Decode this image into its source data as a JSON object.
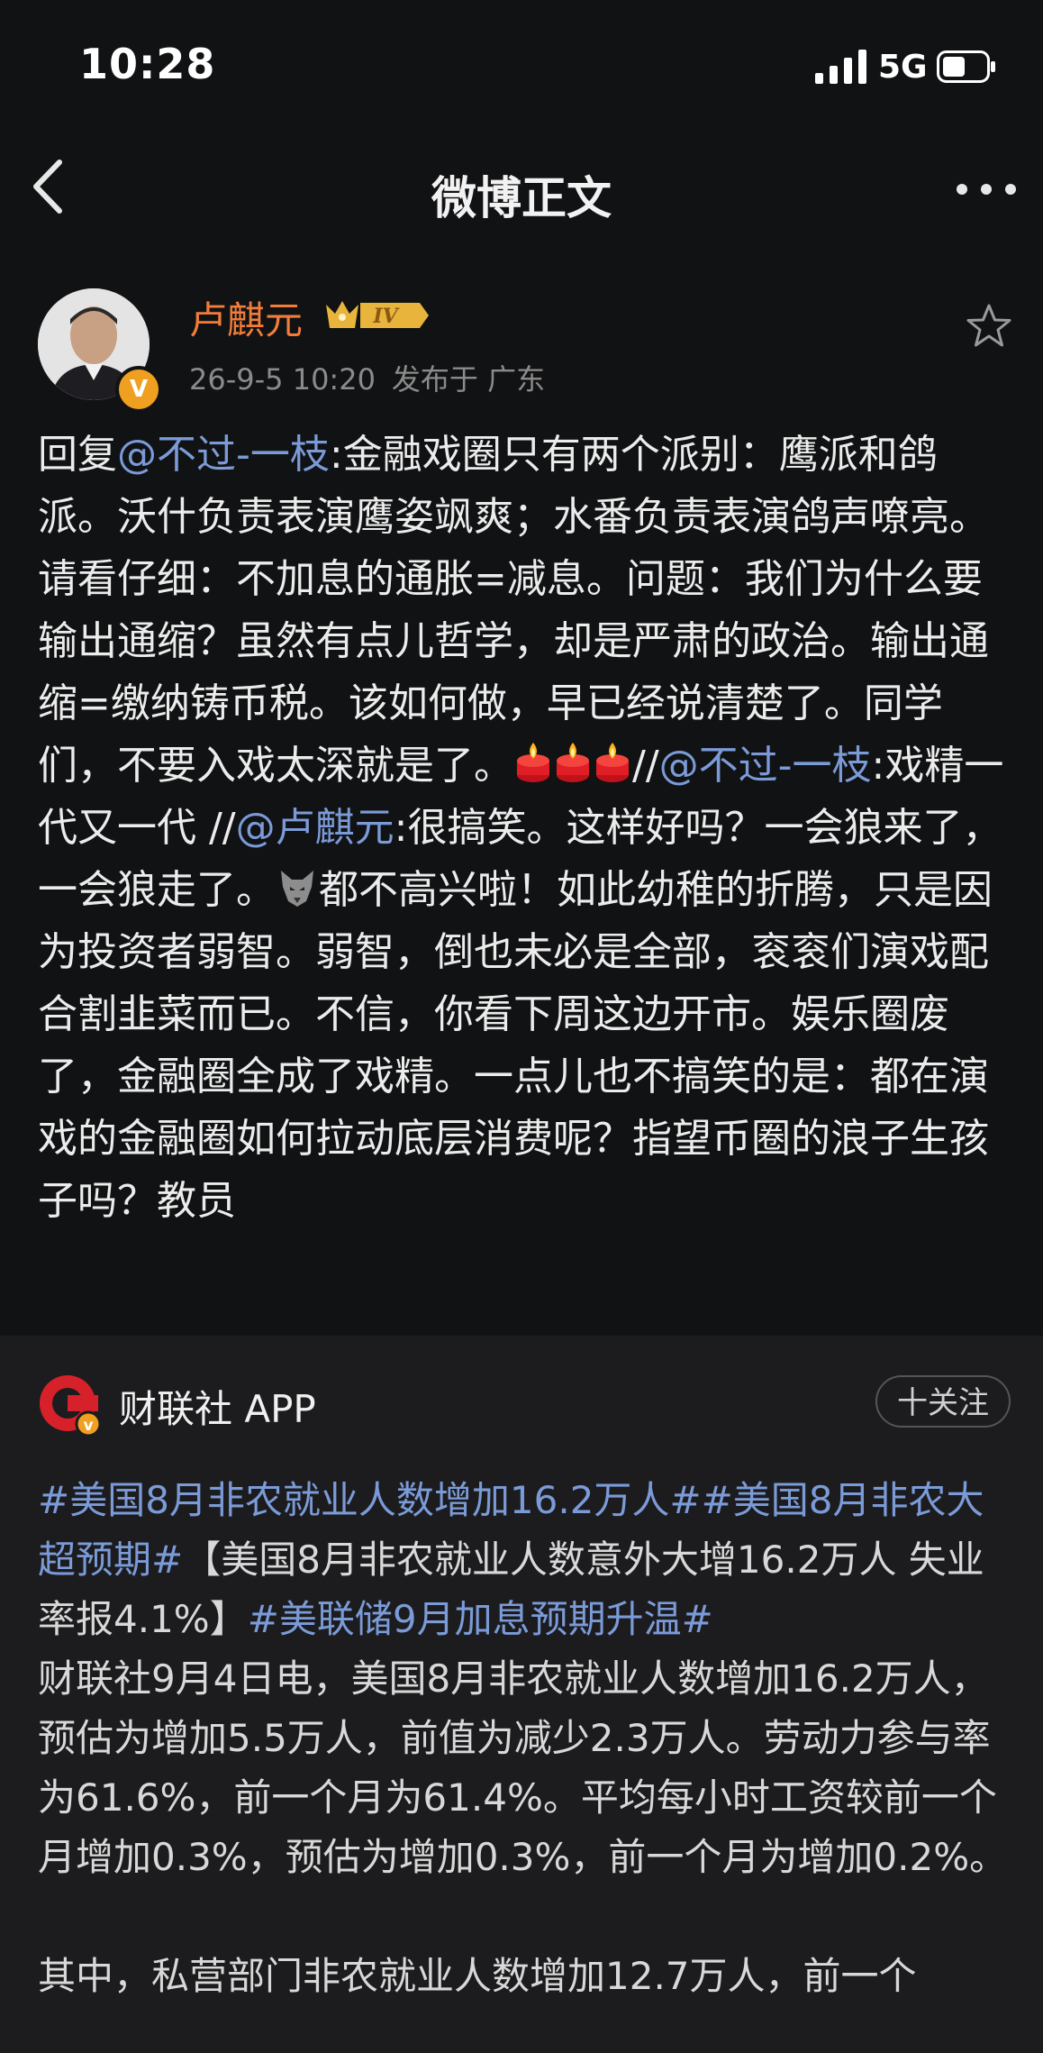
{
  "status_bar": {
    "time": "10:28",
    "network": "5G"
  },
  "nav": {
    "title": "微博正文"
  },
  "author": {
    "name": "卢麒元",
    "level_badge": "IV",
    "verified_badge": "V",
    "timestamp": "26-9-5 10:20",
    "location": "发布于 广东"
  },
  "post": {
    "segments": [
      {
        "text": "回复",
        "link": false
      },
      {
        "text": "@不过-一枝",
        "link": true
      },
      {
        "text": ":金融戏圈只有两个派别：鹰派和鸽派。沃什负责表演鹰姿飒爽；水番负责表演鸽声嘹亮。请看仔细：不加息的通胀=减息。问题：我们为什么要输出通缩？虽然有点儿哲学，却是严肃的政治。输出通缩=缴纳铸币税。该如何做，早已经说清楚了。同学们，不要入戏太深就是了。",
        "link": false
      },
      {
        "emoji": "candle-icon"
      },
      {
        "emoji": "candle-icon"
      },
      {
        "emoji": "candle-icon"
      },
      {
        "text": "//",
        "link": false
      },
      {
        "text": "@不过-一枝",
        "link": true
      },
      {
        "text": ":戏精一代又一代 //",
        "link": false
      },
      {
        "text": "@卢麒元",
        "link": true
      },
      {
        "text": ":很搞笑。这样好吗？一会狼来了，一会狼走了。",
        "link": false
      },
      {
        "emoji": "wolf-icon"
      },
      {
        "text": "都不高兴啦！如此幼稚的折腾，只是因为投资者弱智。弱智，倒也未必是全部，衮衮们演戏配合割韭菜而已。不信，你看下周这边开市。娱乐圈废了，金融圈全成了戏精。一点儿也不搞笑的是：都在演戏的金融圈如何拉动底层消费呢？指望币圈的浪子生孩子吗？教员",
        "link": false
      }
    ]
  },
  "card": {
    "source_name": "财联社 APP",
    "icon_letter": "C",
    "follow_label": "十关注",
    "tags_line": [
      {
        "text": "#美国8月非农就业人数增加16.2万人##美国8月非农大超预期#",
        "tag": true
      },
      {
        "text": "【美国8月非农就业人数意外大增16.2万人 失业率报4.1%】",
        "tag": false
      },
      {
        "text": "#美联储9月加息预期升温#",
        "tag": true
      }
    ],
    "paragraph1": "财联社9月4日电，美国8月非农就业人数增加16.2万人，预估为增加5.5万人，前值为减少2.3万人。劳动力参与率为61.6%，前一个月为61.4%。平均每小时工资较前一个月增加0.3%，预估为增加0.3%，前一个月为增加0.2%。",
    "paragraph2": "其中，私营部门非农就业人数增加12.7万人，前一个"
  },
  "colors": {
    "background": "#111213",
    "card_background": "#1c1c1e",
    "username": "#f27d3a",
    "link": "#7b9bd8",
    "meta": "#8b8b8b"
  }
}
